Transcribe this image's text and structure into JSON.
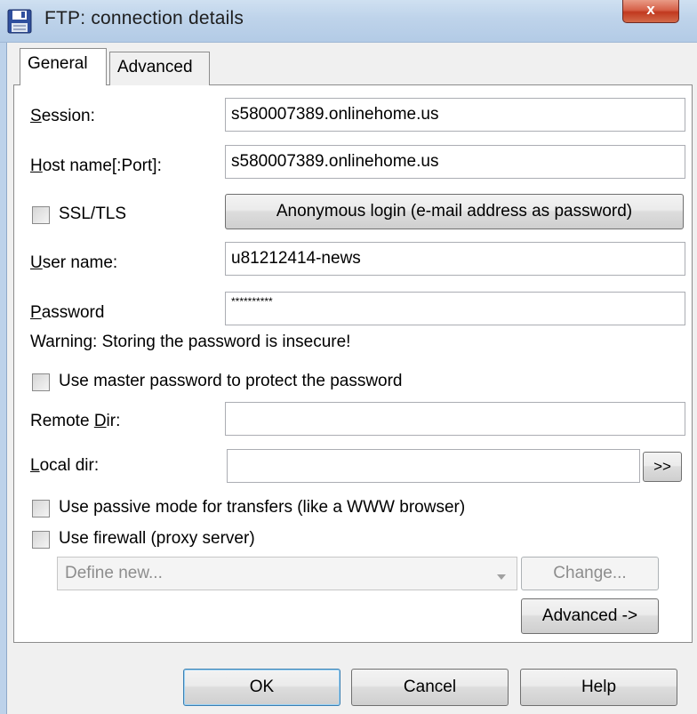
{
  "window": {
    "title": "FTP: connection details",
    "close_glyph": "x"
  },
  "tabs": [
    {
      "label": "General",
      "active": true
    },
    {
      "label": "Advanced",
      "active": false
    }
  ],
  "form": {
    "session": {
      "label_u": "S",
      "label_rest": "ession:",
      "value": "s580007389.onlinehome.us"
    },
    "host": {
      "label_u": "H",
      "label_rest": "ost name[:Port]:",
      "value": "s580007389.onlinehome.us"
    },
    "ssl": {
      "label": "SSL/TLS",
      "checked": false
    },
    "anonymous_button": "Anonymous login (e-mail address as password)",
    "user": {
      "label_u": "U",
      "label_rest": "ser name:",
      "value": "u81212414-news"
    },
    "password": {
      "label_u": "P",
      "label_rest": "assword",
      "value": "**********"
    },
    "warning": "Warning: Storing the password is insecure!",
    "master_password": {
      "label": "Use master password to protect the password",
      "checked": false
    },
    "remote_dir": {
      "label_pre": "Remote ",
      "label_u": "D",
      "label_rest": "ir:",
      "value": ""
    },
    "local_dir": {
      "label_u": "L",
      "label_rest": "ocal dir:",
      "value": "",
      "browse_label": ">>"
    },
    "passive": {
      "label": "Use passive mode for transfers (like a WWW browser)",
      "checked": false
    },
    "firewall": {
      "label": "Use firewall (proxy server)",
      "checked": false
    },
    "proxy_select": {
      "value": "Define new..."
    },
    "change_button": "Change...",
    "advanced_button": "Advanced ->"
  },
  "footer": {
    "ok": "OK",
    "cancel": "Cancel",
    "help": "Help"
  },
  "colors": {
    "titlebar": "#bed3ea",
    "close": "#c1391f",
    "focus": "#3c7fb1"
  },
  "icons": {
    "title": "floppy-disk-icon",
    "close": "close-icon",
    "dropdown": "chevron-down-icon"
  }
}
